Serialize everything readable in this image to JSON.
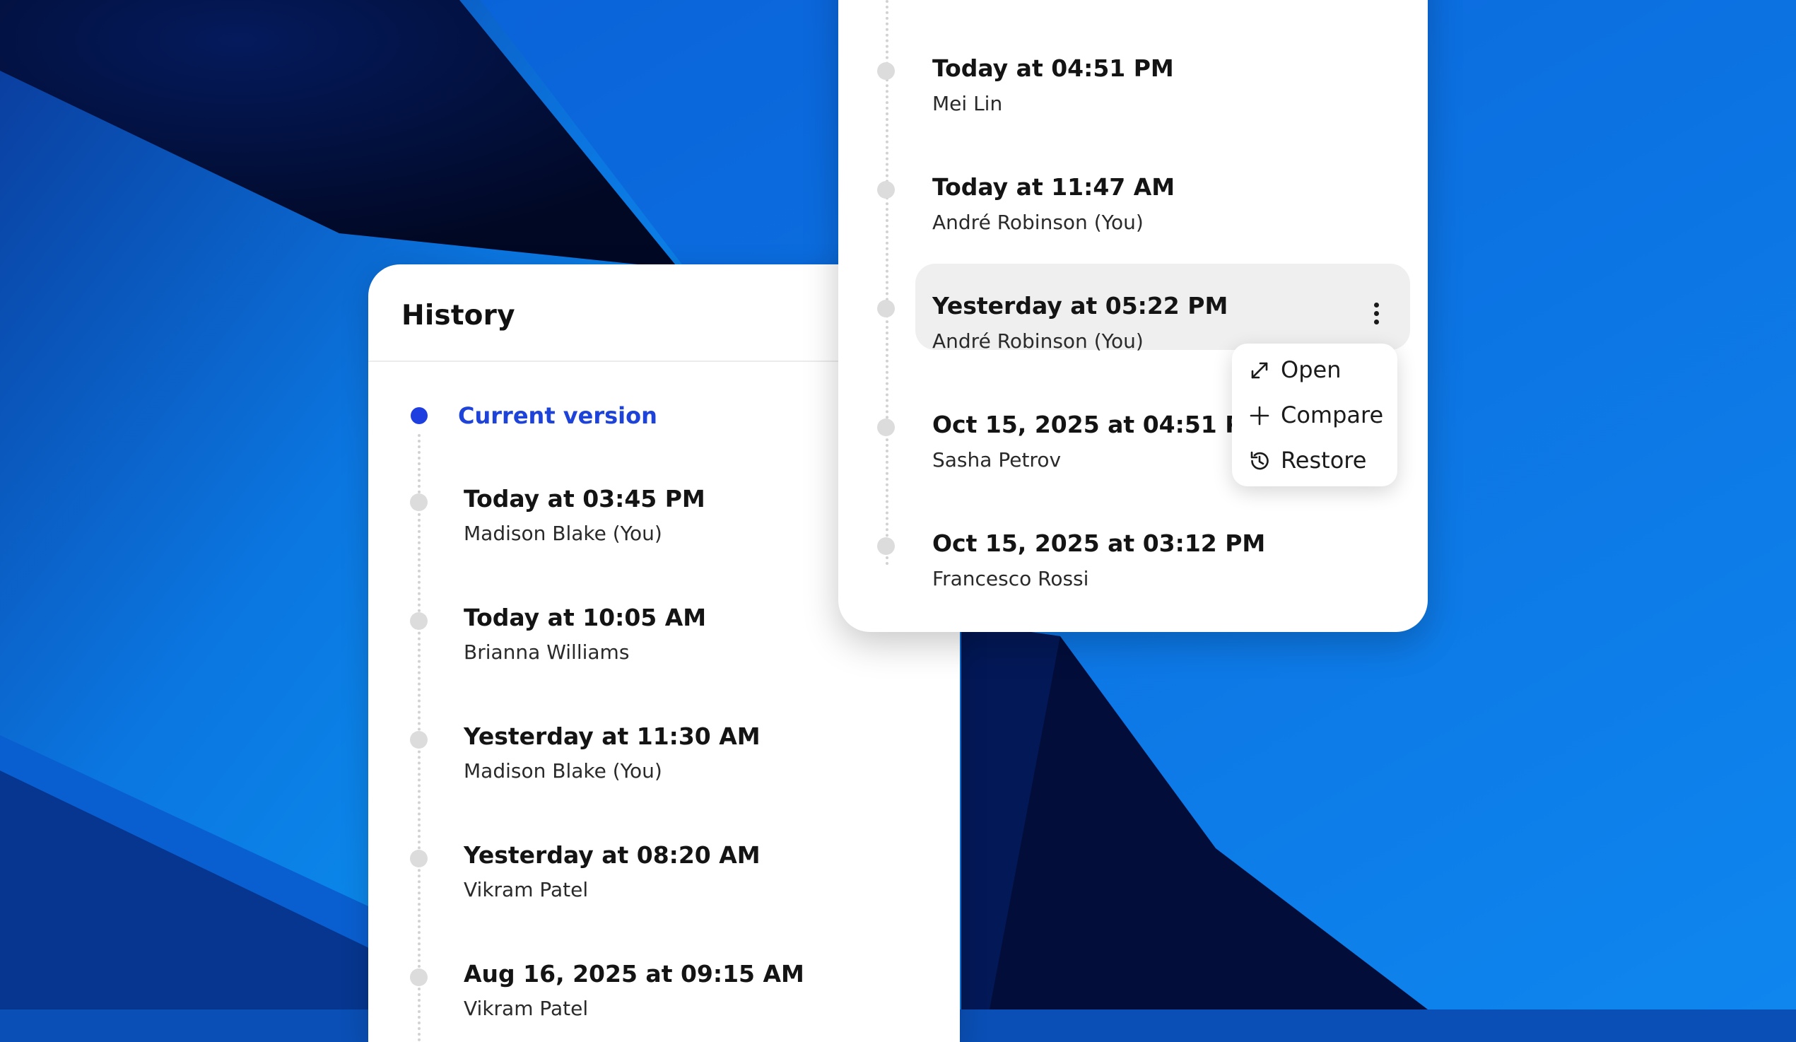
{
  "history": {
    "title": "History",
    "current_version_label": "Current version",
    "items": [
      {
        "date": "Today at 03:45 PM",
        "author": "Madison Blake (You)"
      },
      {
        "date": "Today at 10:05 AM",
        "author": "Brianna Williams"
      },
      {
        "date": "Yesterday at 11:30 AM",
        "author": "Madison Blake (You)"
      },
      {
        "date": "Yesterday at 08:20 AM",
        "author": "Vikram Patel"
      },
      {
        "date": "Aug 16, 2025 at 09:15 AM",
        "author": "Vikram Patel"
      }
    ]
  },
  "versions": {
    "items": [
      {
        "date": "Today at 04:51 PM",
        "author": "Mei Lin"
      },
      {
        "date": "Today at 11:47 AM",
        "author": "André Robinson (You)"
      },
      {
        "date": "Yesterday at 05:22 PM",
        "author": "André Robinson (You)"
      },
      {
        "date": "Oct 15, 2025 at 04:51 PM",
        "author": "Sasha Petrov"
      },
      {
        "date": "Oct 15, 2025 at 03:12 PM",
        "author": "Francesco Rossi"
      }
    ]
  },
  "context_menu": {
    "items": [
      {
        "label": "Open",
        "icon": "expand-icon"
      },
      {
        "label": "Compare",
        "icon": "plus-icon"
      },
      {
        "label": "Restore",
        "icon": "history-restore-icon"
      }
    ]
  },
  "colors": {
    "accent": "#1e43d8",
    "background_blue": "#0a62d8",
    "background_dark": "#020c3a"
  }
}
